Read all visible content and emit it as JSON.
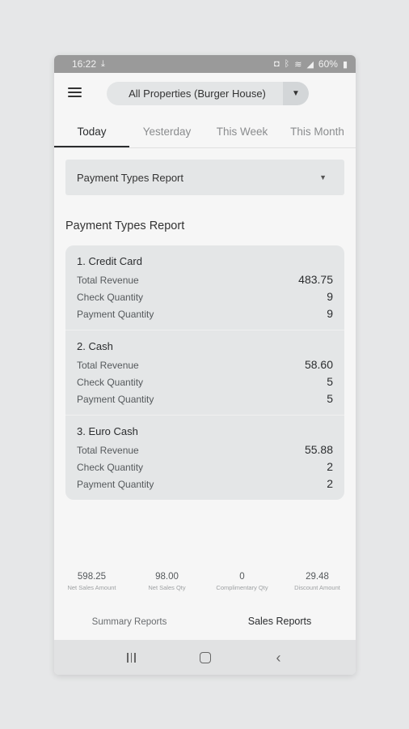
{
  "status_bar": {
    "time": "16:22",
    "battery": "60%"
  },
  "header": {
    "property_selector": "All Properties (Burger House)"
  },
  "tabs": [
    {
      "label": "Today",
      "active": true
    },
    {
      "label": "Yesterday",
      "active": false
    },
    {
      "label": "This Week",
      "active": false
    },
    {
      "label": "This Month",
      "active": false
    }
  ],
  "report_selector": {
    "value": "Payment Types Report"
  },
  "section_title": "Payment Types Report",
  "payments": [
    {
      "title": "1. Credit Card",
      "rows": [
        {
          "label": "Total Revenue",
          "value": "483.75"
        },
        {
          "label": "Check Quantity",
          "value": "9"
        },
        {
          "label": "Payment Quantity",
          "value": "9"
        }
      ]
    },
    {
      "title": "2. Cash",
      "rows": [
        {
          "label": "Total Revenue",
          "value": "58.60"
        },
        {
          "label": "Check Quantity",
          "value": "5"
        },
        {
          "label": "Payment Quantity",
          "value": "5"
        }
      ]
    },
    {
      "title": "3. Euro Cash",
      "rows": [
        {
          "label": "Total Revenue",
          "value": "55.88"
        },
        {
          "label": "Check Quantity",
          "value": "2"
        },
        {
          "label": "Payment Quantity",
          "value": "2"
        }
      ]
    }
  ],
  "summary": [
    {
      "value": "598.25",
      "label": "Net Sales Amount"
    },
    {
      "value": "98.00",
      "label": "Net Sales Qty"
    },
    {
      "value": "0",
      "label": "Complimentary Qty"
    },
    {
      "value": "29.48",
      "label": "Discount Amount"
    }
  ],
  "bottom_nav": [
    {
      "label": "Summary Reports",
      "active": false
    },
    {
      "label": "Sales Reports",
      "active": true
    }
  ],
  "icons": {
    "menu": "hamburger-menu-icon",
    "dropdown": "caret-down-icon",
    "sys_recent": "recent-apps-icon",
    "sys_home": "home-icon",
    "sys_back": "back-icon"
  }
}
